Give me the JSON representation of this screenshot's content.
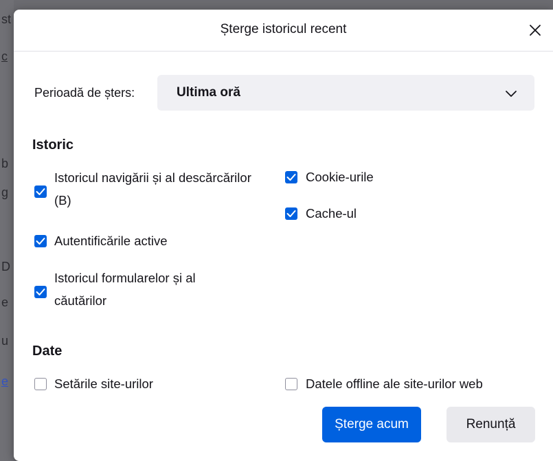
{
  "background_text": [
    "st",
    "c",
    "b",
    "g",
    "D",
    "e",
    "u",
    "e"
  ],
  "dialog": {
    "title": "Șterge istoricul recent",
    "close_icon": "close-icon"
  },
  "period": {
    "label": "Perioadă de șters:",
    "selected": "Ultima oră",
    "dropdown_icon": "chevron-down-icon"
  },
  "history_section": {
    "heading": "Istoric",
    "options": [
      {
        "label_line1": "Istoricul navigării și al descărcărilor",
        "label_line2": "(B)",
        "checked": true
      },
      {
        "label": "Autentificările active",
        "checked": true
      },
      {
        "label_line1": "Istoricul formularelor și al",
        "label_line2": "căutărilor",
        "checked": true
      },
      {
        "label": "Cookie-urile",
        "checked": true
      },
      {
        "label": "Cache-ul",
        "checked": true
      }
    ]
  },
  "data_section": {
    "heading": "Date",
    "options": [
      {
        "label": "Setările site-urilor",
        "checked": false
      },
      {
        "label": "Datele offline ale site-urilor web",
        "checked": false
      }
    ]
  },
  "buttons": {
    "primary": "Șterge acum",
    "secondary": "Renunță"
  },
  "colors": {
    "accent": "#0061e0",
    "secondary_button": "#e9e9ed",
    "select_background": "#f0f0f4"
  }
}
